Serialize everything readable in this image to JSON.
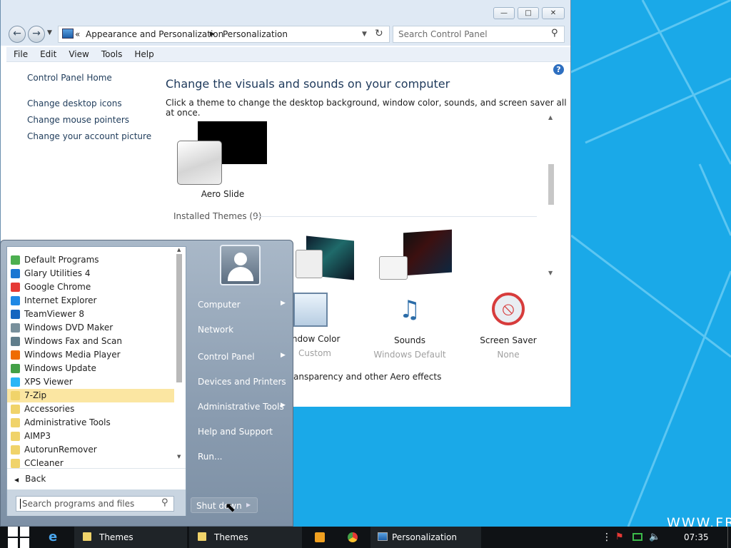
{
  "window": {
    "breadcrumb_sep": "«",
    "breadcrumb": [
      "Appearance and Personalization",
      "Personalization"
    ],
    "search_placeholder": "Search Control Panel",
    "menu": [
      "File",
      "Edit",
      "View",
      "Tools",
      "Help"
    ],
    "buttons": {
      "minimize": "—",
      "maximize": "□",
      "close": "✕"
    }
  },
  "sidebar": {
    "home": "Control Panel Home",
    "links": [
      "Change desktop icons",
      "Change mouse pointers",
      "Change your account picture"
    ]
  },
  "main": {
    "title": "Change the visuals and sounds on your computer",
    "subtitle": "Click a theme to change the desktop background, window color, sounds, and screen saver all at once.",
    "featured_theme": "Aero Slide",
    "installed_label": "Installed Themes (9)",
    "bottom_items": [
      {
        "label": "indow Color",
        "value": "Custom"
      },
      {
        "label": "Sounds",
        "value": "Windows Default"
      },
      {
        "label": "Screen Saver",
        "value": "None"
      }
    ],
    "partial_text": "ansparency and other Aero effects"
  },
  "start_menu": {
    "programs": [
      {
        "name": "Default Programs",
        "icon_color": "#4caf50"
      },
      {
        "name": "Glary Utilities 4",
        "icon_color": "#1976d2"
      },
      {
        "name": "Google Chrome",
        "icon_color": "#e53935"
      },
      {
        "name": "Internet Explorer",
        "icon_color": "#1e88e5"
      },
      {
        "name": "TeamViewer 8",
        "icon_color": "#1565c0"
      },
      {
        "name": "Windows DVD Maker",
        "icon_color": "#78909c"
      },
      {
        "name": "Windows Fax and Scan",
        "icon_color": "#607d8b"
      },
      {
        "name": "Windows Media Player",
        "icon_color": "#ef6c00"
      },
      {
        "name": "Windows Update",
        "icon_color": "#43a047"
      },
      {
        "name": "XPS Viewer",
        "icon_color": "#29b6f6"
      },
      {
        "name": "7-Zip",
        "icon_color": "#f0d36a",
        "selected": true
      },
      {
        "name": "Accessories",
        "icon_color": "#f0d36a"
      },
      {
        "name": "Administrative Tools",
        "icon_color": "#f0d36a"
      },
      {
        "name": "AIMP3",
        "icon_color": "#f0d36a"
      },
      {
        "name": "AutorunRemover",
        "icon_color": "#f0d36a"
      },
      {
        "name": "CCleaner",
        "icon_color": "#f0d36a"
      }
    ],
    "back": "Back",
    "search_placeholder": "Search programs and files",
    "right_items": [
      "Computer",
      "Network",
      "Control Panel",
      "Devices and Printers",
      "Administrative Tools",
      "Help and Support",
      "Run..."
    ],
    "shutdown": "Shut down"
  },
  "taskbar": {
    "buttons": [
      "Themes",
      "Themes",
      "Personalization"
    ],
    "clock": "07:35"
  },
  "watermark": "WWW.FR"
}
